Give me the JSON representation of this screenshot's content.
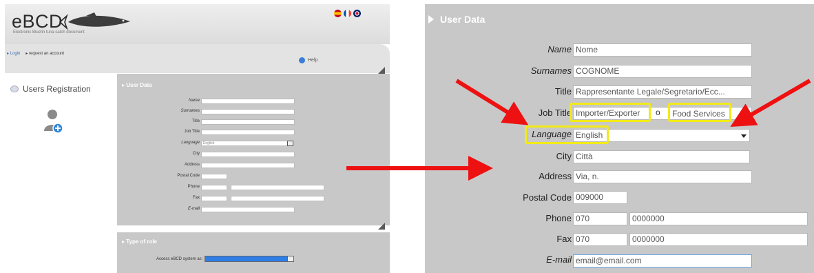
{
  "left_screen": {
    "logo_text": "eBCD",
    "logo_subtitle": "Electronic Bluefin tuna catch document",
    "flags": [
      "spanish-flag-icon",
      "french-flag-icon",
      "uk-flag-icon"
    ],
    "nav": {
      "login_label": "Login",
      "request_label": "request an account"
    },
    "help_label": "Help",
    "sidebar_title": "Users Registration",
    "panel_title": "User Data",
    "fields": [
      {
        "label": "Name"
      },
      {
        "label": "Surnames"
      },
      {
        "label": "Title"
      },
      {
        "label": "Job Title"
      },
      {
        "label": "Language",
        "value": "English"
      },
      {
        "label": "City"
      },
      {
        "label": "Address"
      },
      {
        "label": "Postal Code"
      },
      {
        "label": "Phone"
      },
      {
        "label": "Fax"
      },
      {
        "label": "E-mail"
      }
    ],
    "role_panel_title": "Type of role",
    "role_label": "Access eBCD system as:"
  },
  "right_screen": {
    "panel_title": "User Data",
    "name": {
      "label": "Name",
      "value": "Nome"
    },
    "surnames": {
      "label": "Surnames",
      "value": "COGNOME"
    },
    "title": {
      "label": "Title",
      "value": "Rappresentante Legale/Segretario/Ecc..."
    },
    "job_title": {
      "label": "Job Title",
      "value_a": "Importer/Exporter",
      "separator": "o",
      "value_b": "Food Services"
    },
    "language": {
      "label": "Language",
      "value": "English"
    },
    "city": {
      "label": "City",
      "value": "Città"
    },
    "address": {
      "label": "Address",
      "value": "Via, n."
    },
    "postal_code": {
      "label": "Postal Code",
      "value": "009000"
    },
    "phone": {
      "label": "Phone",
      "prefix": "070",
      "number": "0000000"
    },
    "fax": {
      "label": "Fax",
      "prefix": "070",
      "number": "0000000"
    },
    "email": {
      "label": "E-mail",
      "value": "email@email.com"
    }
  },
  "colors": {
    "highlight": "#f2ea17",
    "arrow": "#ee1111",
    "panel": "#c8c8c8"
  }
}
